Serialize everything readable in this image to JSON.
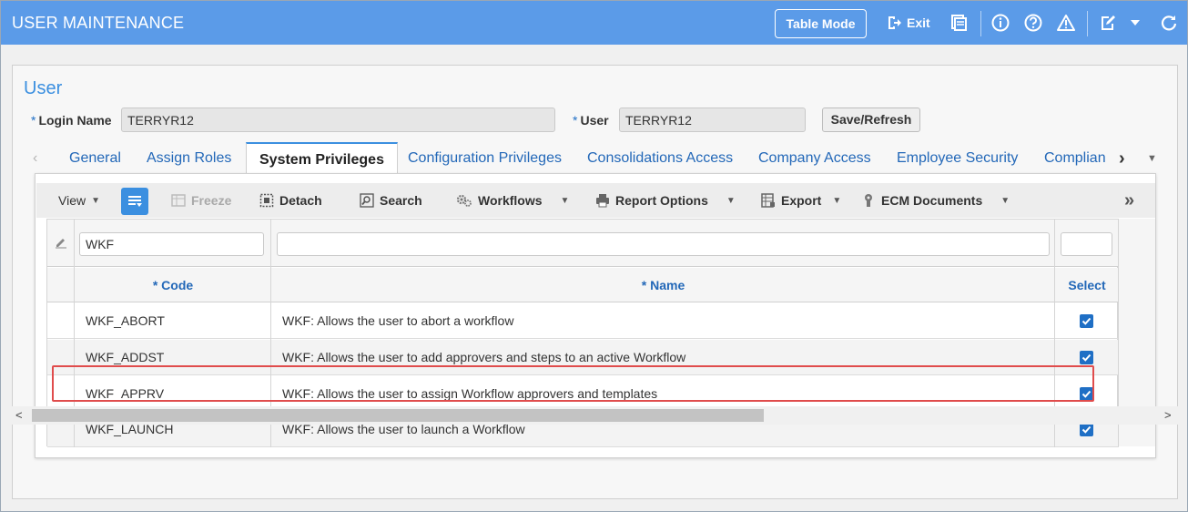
{
  "app": {
    "title": "USER MAINTENANCE"
  },
  "titlebar": {
    "table_mode": "Table Mode",
    "exit": "Exit"
  },
  "colors": {
    "accent": "#5b9be8",
    "link": "#2368b8",
    "checkbox": "#1f6fc5",
    "highlight": "#e04c4c"
  },
  "section": {
    "title": "User"
  },
  "fields": {
    "login_name_label": "Login Name",
    "login_name_value": "TERRYR12",
    "user_label": "User",
    "user_value": "TERRYR12",
    "required_mark": "*"
  },
  "buttons": {
    "save_refresh": "Save/Refresh"
  },
  "tabs": [
    {
      "label": "General"
    },
    {
      "label": "Assign Roles"
    },
    {
      "label": "System Privileges"
    },
    {
      "label": "Configuration Privileges"
    },
    {
      "label": "Consolidations Access"
    },
    {
      "label": "Company Access"
    },
    {
      "label": "Employee Security"
    },
    {
      "label": "Complian"
    }
  ],
  "toolbar": {
    "view": "View",
    "freeze": "Freeze",
    "detach": "Detach",
    "search": "Search",
    "workflows": "Workflows",
    "report_options": "Report Options",
    "export": "Export",
    "ecm_documents": "ECM Documents"
  },
  "grid": {
    "filter_code": "WKF",
    "filter_name": "",
    "filter_select": "",
    "columns": {
      "code": "* Code",
      "name": "* Name",
      "select": "Select"
    },
    "rows": [
      {
        "code": "WKF_ABORT",
        "name": "WKF: Allows the user to abort a workflow",
        "selected": true
      },
      {
        "code": "WKF_ADDST",
        "name": "WKF: Allows the user to add approvers and steps to an active Workflow",
        "selected": true
      },
      {
        "code": "WKF_APPRV",
        "name": "WKF: Allows the user to assign Workflow approvers and templates",
        "selected": true
      },
      {
        "code": "WKF_LAUNCH",
        "name": "WKF: Allows the user to launch a Workflow",
        "selected": true
      }
    ]
  }
}
